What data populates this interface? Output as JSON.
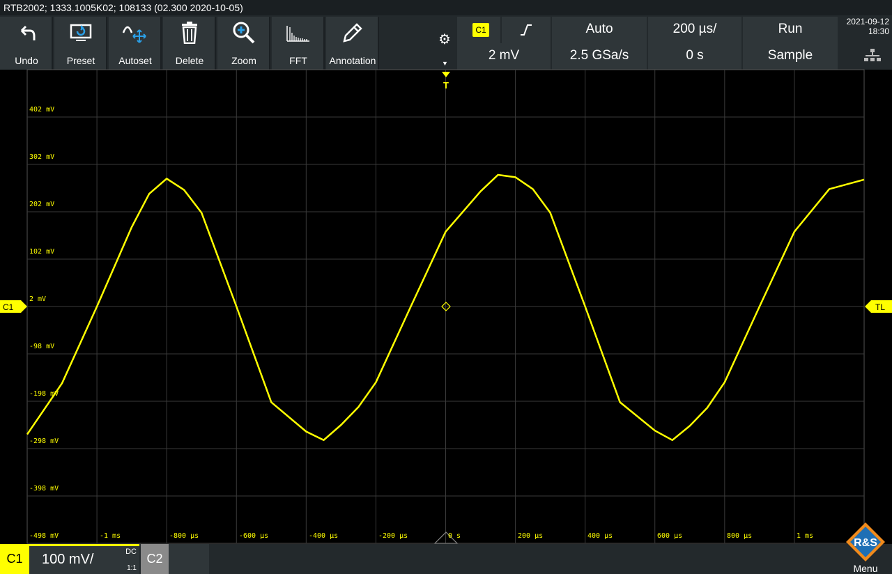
{
  "title_bar": "RTB2002; 1333.1005K02; 108133 (02.300 2020-10-05)",
  "toolbar": [
    {
      "label": "Undo",
      "icon": "undo-icon"
    },
    {
      "label": "Preset",
      "icon": "preset-icon"
    },
    {
      "label": "Autoset",
      "icon": "autoset-icon"
    },
    {
      "label": "Delete",
      "icon": "delete-icon"
    },
    {
      "label": "Zoom",
      "icon": "zoom-icon"
    },
    {
      "label": "FFT",
      "icon": "fft-icon"
    },
    {
      "label": "Annotation",
      "icon": "annotation-icon"
    }
  ],
  "settings": {
    "trigger_source": "C1",
    "trigger_slope_icon": "rising-edge-icon",
    "trigger_mode": "Auto",
    "time_scale": "200 µs/",
    "run_state": "Run",
    "trigger_level": "2 mV",
    "sample_rate": "2.5 GSa/s",
    "time_offset": "0 s",
    "acquisition": "Sample"
  },
  "datetime": {
    "date": "2021-09-12",
    "time": "18:30"
  },
  "y_labels": [
    "402 mV",
    "302 mV",
    "202 mV",
    "102 mV",
    "2 mV",
    "-98 mV",
    "-198 mV",
    "-298 mV",
    "-398 mV",
    "-498 mV"
  ],
  "x_labels": [
    "-1 ms",
    "-800 µs",
    "-600 µs",
    "-400 µs",
    "-200 µs",
    "0 s",
    "200 µs",
    "400 µs",
    "600 µs",
    "800 µs",
    "1 ms"
  ],
  "markers": {
    "channel": "C1",
    "trigger_level": "TL",
    "trigger_pos": "T"
  },
  "bottom": {
    "channel1": "C1",
    "scale": "100 mV/",
    "coupling": "DC",
    "probe": "1:1",
    "channel2": "C2"
  },
  "menu": {
    "label": "Menu"
  },
  "colors": {
    "trace": "#ffff00",
    "background": "#000000",
    "grid": "#3a3a3a",
    "panel": "#2f3639"
  },
  "chart_data": {
    "type": "line",
    "xlabel": "",
    "ylabel": "",
    "xlim": [
      -1.2,
      1.2
    ],
    "ylim": [
      -498,
      502
    ],
    "series": [
      {
        "values_x_ms": [
          -1.2,
          -1.1,
          -1.0,
          -0.9,
          -0.85,
          -0.8,
          -0.75,
          -0.7,
          -0.6,
          -0.5,
          -0.4,
          -0.35,
          -0.3,
          -0.25,
          -0.2,
          -0.1,
          0.0,
          0.1,
          0.15,
          0.2,
          0.25,
          0.3,
          0.4,
          0.5,
          0.6,
          0.65,
          0.7,
          0.75,
          0.8,
          0.9,
          1.0,
          1.1,
          1.2
        ],
        "values_mv": [
          -268,
          -160,
          2,
          170,
          240,
          272,
          248,
          200,
          2,
          -200,
          -262,
          -280,
          -248,
          -210,
          -158,
          2,
          160,
          245,
          280,
          275,
          250,
          200,
          2,
          -200,
          -260,
          -280,
          -250,
          -212,
          -158,
          2,
          160,
          250,
          270
        ]
      }
    ]
  }
}
